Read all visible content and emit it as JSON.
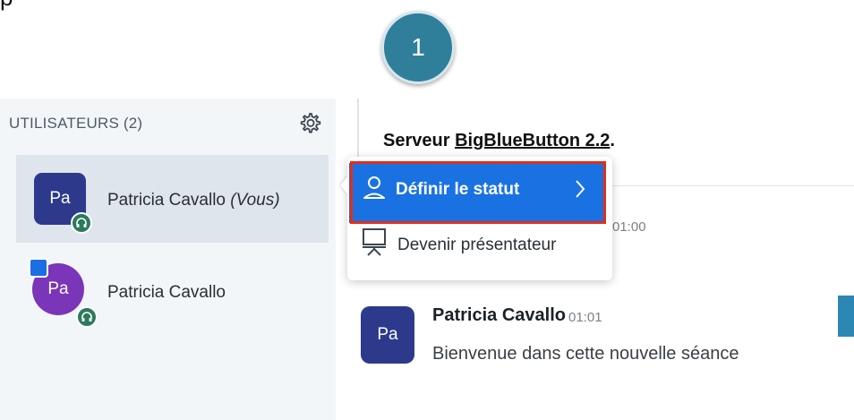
{
  "step_number": "1",
  "user_panel": {
    "title": "UTILISATEURS (2)",
    "users": [
      {
        "initials": "Pa",
        "name": "Patricia Cavallo",
        "suffix": "(Vous)"
      },
      {
        "initials": "Pa",
        "name": "Patricia Cavallo"
      }
    ]
  },
  "chat": {
    "welcome_prefix": "Serveur ",
    "welcome_link": "BigBlueButton 2.2",
    "welcome_suffix": ".",
    "hidden_time": "01:00",
    "message": {
      "initials": "Pa",
      "sender": "Patricia Cavallo",
      "time": "01:01",
      "text": "Bienvenue dans cette nouvelle séance"
    }
  },
  "context_menu": {
    "items": [
      {
        "label": "Définir le statut",
        "icon": "user-icon",
        "has_submenu": true
      },
      {
        "label": "Devenir présentateur",
        "icon": "presentation-icon"
      }
    ]
  },
  "colors": {
    "accent": "#1a72e2",
    "highlight": "#e12e1a",
    "avatar_blue": "#2d3a8c",
    "avatar_purple": "#7b35b8",
    "audio_green": "#2c7a5d",
    "step_badge": "#2f7f9b"
  }
}
